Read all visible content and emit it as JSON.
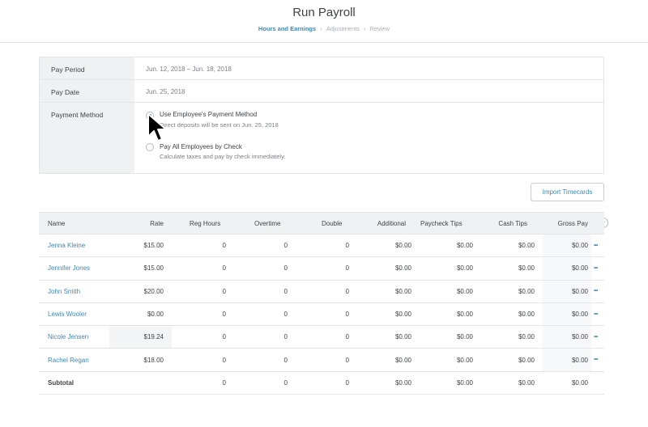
{
  "header": {
    "title": "Run Payroll",
    "steps": [
      "Hours and Earnings",
      "Adjustments",
      "Review"
    ],
    "active_step": 0
  },
  "info": {
    "pay_period_label": "Pay Period",
    "pay_period_value": "Jun. 12, 2018 – Jun. 18, 2018",
    "pay_date_label": "Pay Date",
    "pay_date_value": "Jun. 25, 2018",
    "payment_method_label": "Payment Method",
    "options": [
      {
        "title": "Use Employee's Payment Method",
        "subtitle": "Direct deposits will be sent on Jun. 25, 2018",
        "selected": true
      },
      {
        "title": "Pay All Employees by Check",
        "subtitle": "Calculate taxes and pay by check immediately.",
        "selected": false
      }
    ]
  },
  "import_button_label": "Import Timecards",
  "table": {
    "columns": [
      "Name",
      "Rate",
      "Reg Hours",
      "Overtime",
      "Double",
      "Additional",
      "Paycheck Tips",
      "Cash Tips",
      "Gross Pay"
    ],
    "rows": [
      [
        "Jenna Kleine",
        "$15.00",
        "0",
        "0",
        "0",
        "$0.00",
        "$0.00",
        "$0.00",
        "$0.00"
      ],
      [
        "Jennifer Jones",
        "$15.00",
        "0",
        "0",
        "0",
        "$0.00",
        "$0.00",
        "$0.00",
        "$0.00"
      ],
      [
        "John Smith",
        "$20.00",
        "0",
        "0",
        "0",
        "$0.00",
        "$0.00",
        "$0.00",
        "$0.00"
      ],
      [
        "Lewis Wooler",
        "$0.00",
        "0",
        "0",
        "0",
        "$0.00",
        "$0.00",
        "$0.00",
        "$0.00"
      ],
      [
        "Nicole Jensen",
        "$19.24",
        "0",
        "0",
        "0",
        "$0.00",
        "$0.00",
        "$0.00",
        "$0.00"
      ],
      [
        "Rachel Regan",
        "$18.00",
        "0",
        "0",
        "0",
        "$0.00",
        "$0.00",
        "$0.00",
        "$0.00"
      ]
    ],
    "subtotal": [
      "Subtotal",
      "",
      "0",
      "0",
      "0",
      "$0.00",
      "$0.00",
      "$0.00",
      "$0.00"
    ],
    "more_icon": "ellipsis-icon",
    "add_column_icon": "plus-icon"
  },
  "colors": {
    "accent": "#3f87b5",
    "label_bg": "#f0f1f3",
    "border": "#e3e5e8"
  }
}
